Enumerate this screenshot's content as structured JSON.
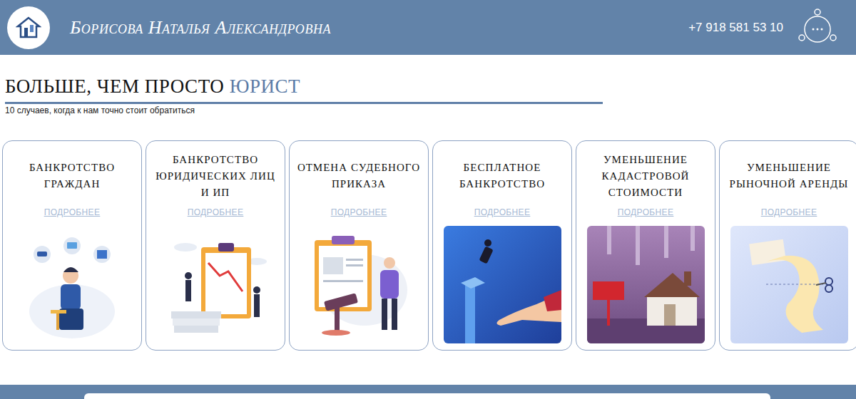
{
  "header": {
    "name": "Борисова Наталья Александровна",
    "phone": "+7 918 581 53 10"
  },
  "heading": {
    "text": "БОЛЬШЕ, ЧЕМ ПРОСТО ",
    "accent": "ЮРИСТ",
    "subtitle": "10 случаев, когда к нам точно стоит обратиться"
  },
  "cards": [
    {
      "title": "БАНКРОТСТВО ГРАЖДАН",
      "link": "ПОДРОБНЕЕ",
      "kind": "illustration"
    },
    {
      "title": "БАНКРОТСТВО ЮРИДИЧЕСКИХ ЛИЦ И ИП",
      "link": "ПОДРОБНЕЕ",
      "kind": "illustration"
    },
    {
      "title": "ОТМЕНА СУДЕБНОГО ПРИКАЗА",
      "link": "ПОДРОБНЕЕ",
      "kind": "illustration"
    },
    {
      "title": "БЕСПЛАТНОЕ БАНКРОТСТВО",
      "link": "ПОДРОБНЕЕ",
      "kind": "picture"
    },
    {
      "title": "УМЕНЬШЕНИЕ КАДАСТРОВОЙ СТОИМОСТИ",
      "link": "ПОДРОБНЕЕ",
      "kind": "picture"
    },
    {
      "title": "УМЕНЬШЕНИЕ РЫНОЧНОЙ АРЕНДЫ",
      "link": "ПОДРОБНЕЕ",
      "kind": "picture"
    }
  ]
}
